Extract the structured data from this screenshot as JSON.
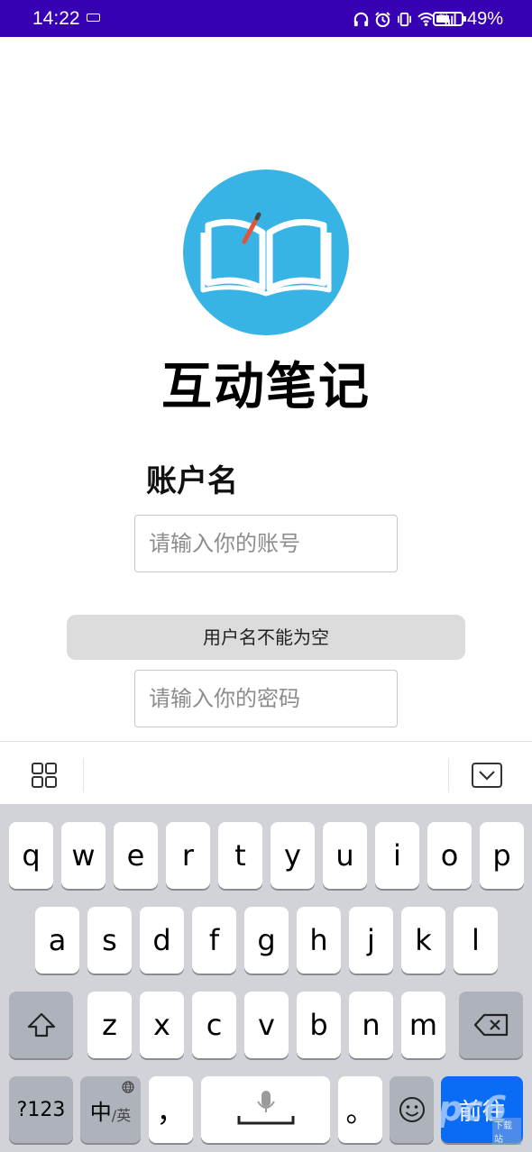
{
  "status_bar": {
    "time": "14:22",
    "battery": "49%"
  },
  "app": {
    "title": "互动笔记",
    "account_label": "账户名",
    "account_placeholder": "请输入你的账号",
    "password_placeholder": "请输入你的密码",
    "toast": "用户名不能为空",
    "logo_color": "#37b4e5",
    "logo_icon": "open-book-icon"
  },
  "keyboard": {
    "row1": [
      "q",
      "w",
      "e",
      "r",
      "t",
      "y",
      "u",
      "i",
      "o",
      "p"
    ],
    "row2": [
      "a",
      "s",
      "d",
      "f",
      "g",
      "h",
      "j",
      "k",
      "l"
    ],
    "row3": [
      "z",
      "x",
      "c",
      "v",
      "b",
      "n",
      "m"
    ],
    "num_key": "?123",
    "lang_key_main": "中",
    "lang_key_sub": "/英",
    "comma": "，",
    "period": "。",
    "go_key": "前往",
    "go_color": "#0a6bf5"
  },
  "watermark": {
    "text": "pc6",
    "sub": "下载站"
  }
}
